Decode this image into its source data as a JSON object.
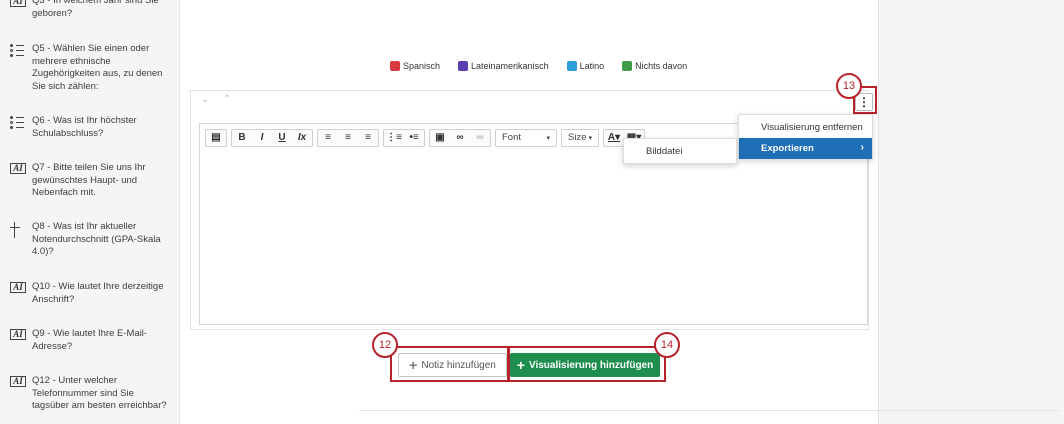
{
  "sidebar": {
    "items": [
      {
        "icon": "text-entry-icon",
        "label": "Q3 - In welchem Jahr sind Sie geboren?"
      },
      {
        "icon": "multiple-choice-icon",
        "label": "Q5 - Wählen Sie einen oder mehrere ethnische Zugehörigkeiten aus, zu denen Sie sich zählen:"
      },
      {
        "icon": "multiple-choice-icon",
        "label": "Q6 - Was ist Ihr höchster Schulabschluss?"
      },
      {
        "icon": "text-entry-icon",
        "label": "Q7 - Bitte teilen Sie uns Ihr gewünschtes Haupt- und Nebenfach mit."
      },
      {
        "icon": "slider-icon",
        "label": "Q8 - Was ist Ihr aktueller Notendurchschnitt (GPA-Skala 4.0)?"
      },
      {
        "icon": "text-entry-icon",
        "label": "Q10 - Wie lautet Ihre derzeitige Anschrift?"
      },
      {
        "icon": "text-entry-icon",
        "label": "Q9 - Wie lautet Ihre E-Mail-Adresse?"
      },
      {
        "icon": "text-entry-icon",
        "label": "Q12 - Unter welcher Telefonnummer sind Sie tagsüber am besten erreichbar?"
      }
    ]
  },
  "legend": [
    {
      "label": "Spanisch",
      "color": "#d93a3f"
    },
    {
      "label": "Lateinamerikanisch",
      "color": "#5b3fb0"
    },
    {
      "label": "Latino",
      "color": "#2a9fd8"
    },
    {
      "label": "Nichts davon",
      "color": "#3f9b4a"
    }
  ],
  "toolbar": {
    "font_label": "Font",
    "size_label": "Size"
  },
  "menu": {
    "remove_label": "Visualisierung entfernen",
    "export_label": "Exportieren",
    "submenu_image_label": "Bilddatei"
  },
  "callouts": {
    "c12": "12",
    "c13": "13",
    "c14": "14"
  },
  "buttons": {
    "add_note_label": "Notiz hinzufügen",
    "add_viz_label": "Visualisierung hinzufügen"
  },
  "colors": {
    "accent_green": "#1e8e4e",
    "menu_blue": "#1f6fb6",
    "callout_red": "#b8232b"
  }
}
